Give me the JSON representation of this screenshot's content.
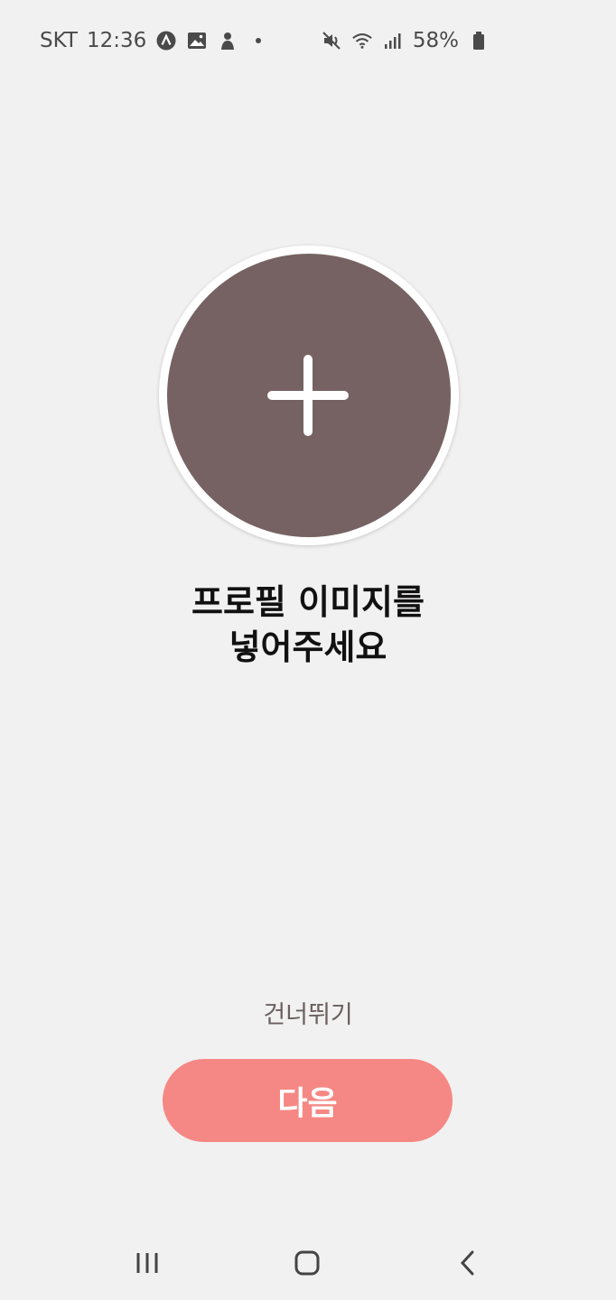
{
  "status_bar": {
    "carrier": "SKT",
    "time": "12:36",
    "battery_percent": "58%",
    "left_icons": [
      "app-a-icon",
      "gallery-icon",
      "avatar-notification-icon",
      "more-dot-icon"
    ],
    "right_icons": [
      "mute-vibrate-icon",
      "wifi-icon",
      "signal-icon",
      "battery-icon"
    ]
  },
  "profile_picker": {
    "icon": "plus-icon",
    "circle_color": "#766262"
  },
  "title": {
    "line1": "프로필 이미지를",
    "line2": "넣어주세요"
  },
  "skip_label": "건너뛰기",
  "next_button": {
    "label": "다음",
    "color": "#f58884"
  },
  "nav_bar": {
    "icons": [
      "recents-icon",
      "home-icon",
      "back-icon"
    ]
  }
}
